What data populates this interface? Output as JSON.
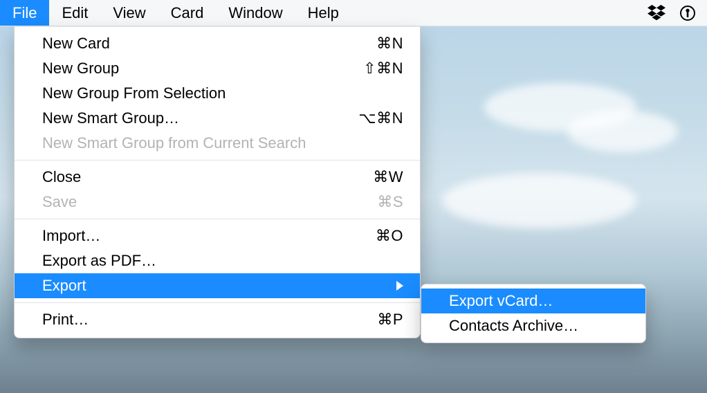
{
  "menubar": {
    "items": [
      {
        "label": "File",
        "active": true
      },
      {
        "label": "Edit"
      },
      {
        "label": "View"
      },
      {
        "label": "Card"
      },
      {
        "label": "Window"
      },
      {
        "label": "Help"
      }
    ],
    "status_icons": [
      "dropbox-icon",
      "onepassword-icon"
    ]
  },
  "file_menu": {
    "groups": [
      [
        {
          "label": "New Card",
          "shortcut": "⌘N"
        },
        {
          "label": "New Group",
          "shortcut": "⇧⌘N"
        },
        {
          "label": "New Group From Selection"
        },
        {
          "label": "New Smart Group…",
          "shortcut": "⌥⌘N"
        },
        {
          "label": "New Smart Group from Current Search",
          "disabled": true
        }
      ],
      [
        {
          "label": "Close",
          "shortcut": "⌘W"
        },
        {
          "label": "Save",
          "shortcut": "⌘S",
          "disabled": true
        }
      ],
      [
        {
          "label": "Import…",
          "shortcut": "⌘O"
        },
        {
          "label": "Export as PDF…"
        },
        {
          "label": "Export",
          "submenu": true,
          "selected": true
        }
      ],
      [
        {
          "label": "Print…",
          "shortcut": "⌘P"
        }
      ]
    ]
  },
  "export_submenu": {
    "items": [
      {
        "label": "Export vCard…",
        "selected": true
      },
      {
        "label": "Contacts Archive…"
      }
    ]
  }
}
